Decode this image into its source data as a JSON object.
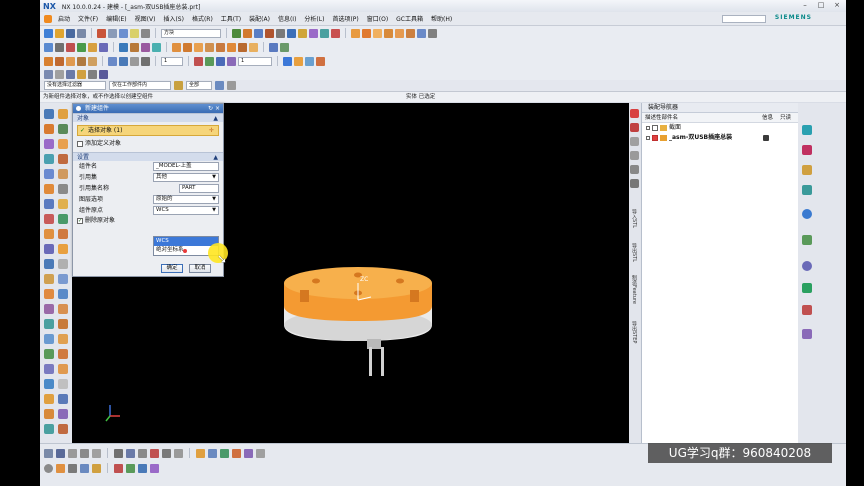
{
  "window": {
    "logo": "NX",
    "title": "NX 10.0.0.24 - 建模 - [_asm-双USB插座总装.prt]",
    "brand": "SIEMENS",
    "controls": [
      "–",
      "□",
      "×"
    ]
  },
  "menu": {
    "items": [
      "文件(F)",
      "编辑(E)",
      "视图(V)",
      "插入(S)",
      "格式(R)",
      "工具(T)",
      "装配(A)",
      "信息(I)",
      "分析(L)",
      "首选项(P)",
      "窗口(O)",
      "GC工具箱",
      "帮助(H)"
    ],
    "start_label": "启动"
  },
  "toolbar": {
    "search_field": "方块",
    "layer_field": "1",
    "scale_field": "1"
  },
  "selection_bar": {
    "filter": "没有选择过滤器",
    "scope": "仅在工作部件内",
    "assembly": "全部"
  },
  "cue_line": {
    "prompt": "为新组件选择对象，或不作选择以创建空组件",
    "status": "实体 已选定"
  },
  "dialog": {
    "title": "新建组件",
    "title_controls": "↻ ×",
    "group_objects": "对象",
    "select_object": "选择对象 (1)",
    "add_defined": "添加定义对象",
    "group_settings": "设置",
    "fields": [
      {
        "label": "组件名",
        "value": "_MODEL-上盖"
      },
      {
        "label": "引用集",
        "value": "其他"
      },
      {
        "label": "引用集名称",
        "value": "PART"
      },
      {
        "label": "图层选项",
        "value": "原始的"
      },
      {
        "label": "组件原点",
        "value": "WCS"
      }
    ],
    "delete_original": "删除原对象",
    "dropdown_options": [
      "WCS",
      "绝对坐标系"
    ],
    "ok": "确定",
    "cancel": "取消"
  },
  "viewport": {
    "axis_label": "ZC",
    "colors": {
      "cap_orange": "#f49a32",
      "base_white": "#eeeeee",
      "pins": "#d0d0d0"
    }
  },
  "navigator": {
    "title": "装配导航器",
    "columns": [
      "描述性部件名",
      "信息",
      "只读"
    ],
    "rows": [
      {
        "label": "截面",
        "indent": 0
      },
      {
        "label": "_asm-双USB插座总装",
        "indent": 1
      }
    ]
  },
  "side_tabs": [
    "导入STL",
    "导出STL",
    "制造Feature",
    "导出STEP"
  ],
  "overlay": {
    "text": "UG学习q群：960840208"
  }
}
